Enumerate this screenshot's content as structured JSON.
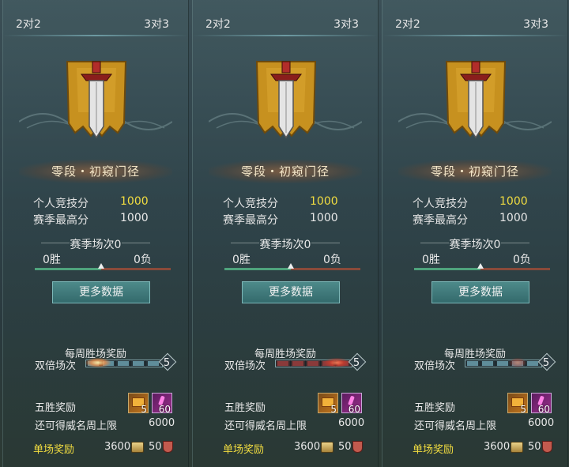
{
  "panels": [
    {
      "tabs": {
        "left": "2对2",
        "right": "3对3"
      },
      "rank": "零段・初窥门径",
      "personal_score_label": "个人竞技分",
      "personal_score_value": "1000",
      "season_high_label": "赛季最高分",
      "season_high_value": "1000",
      "season_matches": "赛季场次0",
      "wins": "0胜",
      "losses": "0负",
      "more_button": "更多数据",
      "weekly_reward": "每周胜场奖励",
      "double_label": "双倍场次",
      "double_count": "5",
      "five_win_label": "五胜奖励",
      "item1_count": "5",
      "item2_count": "60",
      "fame_limit_label": "还可得威名周上限",
      "fame_limit_value": "6000",
      "single_label": "单场奖励",
      "single_coin": "3600",
      "single_honor": "50"
    },
    {
      "tabs": {
        "left": "2对2",
        "right": "3对3"
      },
      "rank": "零段・初窥门径",
      "personal_score_label": "个人竞技分",
      "personal_score_value": "1000",
      "season_high_label": "赛季最高分",
      "season_high_value": "1000",
      "season_matches": "赛季场次0",
      "wins": "0胜",
      "losses": "0负",
      "more_button": "更多数据",
      "weekly_reward": "每周胜场奖励",
      "double_label": "双倍场次",
      "double_count": "5",
      "five_win_label": "五胜奖励",
      "item1_count": "5",
      "item2_count": "60",
      "fame_limit_label": "还可得威名周上限",
      "fame_limit_value": "6000",
      "single_label": "单场奖励",
      "single_coin": "3600",
      "single_honor": "50"
    },
    {
      "tabs": {
        "left": "2对2",
        "right": "3对3"
      },
      "rank": "零段・初窥门径",
      "personal_score_label": "个人竞技分",
      "personal_score_value": "1000",
      "season_high_label": "赛季最高分",
      "season_high_value": "1000",
      "season_matches": "赛季场次0",
      "wins": "0胜",
      "losses": "0负",
      "more_button": "更多数据",
      "weekly_reward": "每周胜场奖励",
      "double_label": "双倍场次",
      "double_count": "5",
      "five_win_label": "五胜奖励",
      "item1_count": "5",
      "item2_count": "60",
      "fame_limit_label": "还可得威名周上限",
      "fame_limit_value": "6000",
      "single_label": "单场奖励",
      "single_coin": "3600",
      "single_honor": "50"
    }
  ],
  "icons": {
    "emblem": "sword-banner-icon",
    "item1": "treasure-chest-icon",
    "item2": "potion-icon",
    "coin": "coin-icon",
    "honor": "shield-icon"
  },
  "colors": {
    "gold": "#f2dd40",
    "button": "#346a6c",
    "win_bar": "#4fa37c",
    "loss_bar": "#8a4a3a"
  }
}
